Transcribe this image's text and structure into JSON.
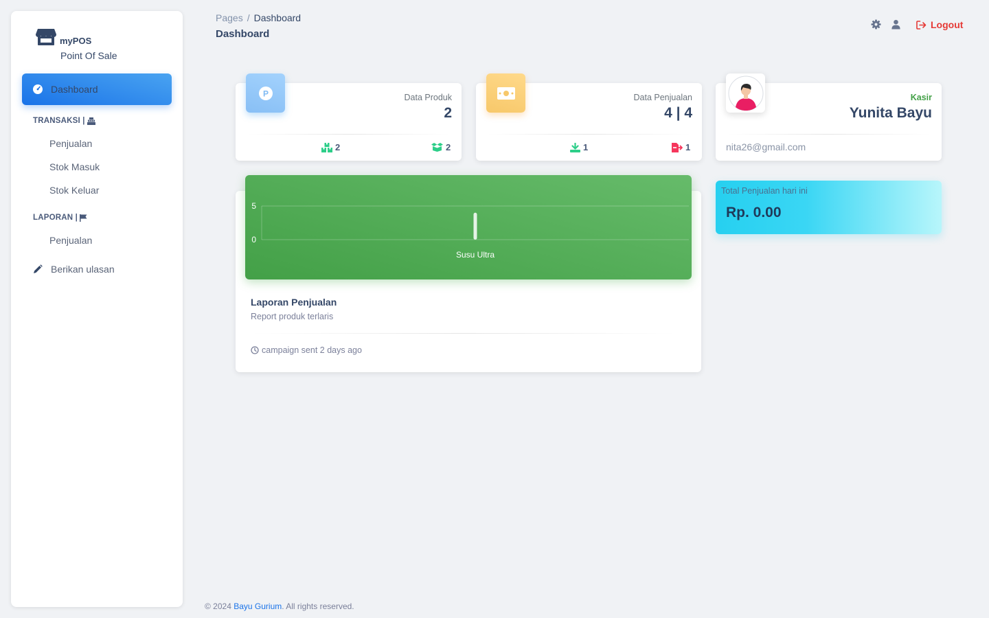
{
  "sidebar": {
    "brand_title": "myPOS",
    "brand_subtitle": "Point Of Sale",
    "active_item": "Dashboard",
    "section_transaksi": "TRANSAKSI |",
    "transaksi_items": [
      "Penjualan",
      "Stok Masuk",
      "Stok Keluar"
    ],
    "section_laporan": "LAPORAN |",
    "laporan_items": [
      "Penjualan"
    ],
    "review_label": "Berikan ulasan"
  },
  "header": {
    "breadcrumb_root": "Pages",
    "breadcrumb_sep": "/",
    "breadcrumb_current": "Dashboard",
    "page_title": "Dashboard",
    "logout_label": "Logout"
  },
  "cards": {
    "produk": {
      "label": "Data Produk",
      "value": "2",
      "foot_left": "2",
      "foot_right": "2",
      "icon_letter": "P"
    },
    "penjualan": {
      "label": "Data Penjualan",
      "value": "4 | 4",
      "foot_left": "1",
      "foot_right": "1"
    },
    "profile": {
      "role": "Kasir",
      "name": "Yunita Bayu",
      "email": "nita26@gmail.com"
    }
  },
  "chart_data": {
    "type": "bar",
    "categories": [
      "Susu Ultra"
    ],
    "values": [
      4
    ],
    "ylim": [
      0,
      5
    ],
    "yticks": [
      "5",
      "0"
    ],
    "grid": true,
    "title": "",
    "xlabel": "",
    "ylabel": ""
  },
  "chart_card": {
    "title": "Laporan Penjualan",
    "subtitle": "Report produk terlaris",
    "footer": "campaign sent 2 days ago"
  },
  "total": {
    "label": "Total Penjualan hari ini",
    "value": "Rp. 0.00"
  },
  "footer": {
    "prefix": "© 2024 ",
    "link": "Bayu Gurium",
    "suffix": ". All rights reserved."
  },
  "colors": {
    "primary": "#1A73E8",
    "success": "#4CAF50",
    "logout": "#e53935",
    "kasir": "#43a047"
  }
}
